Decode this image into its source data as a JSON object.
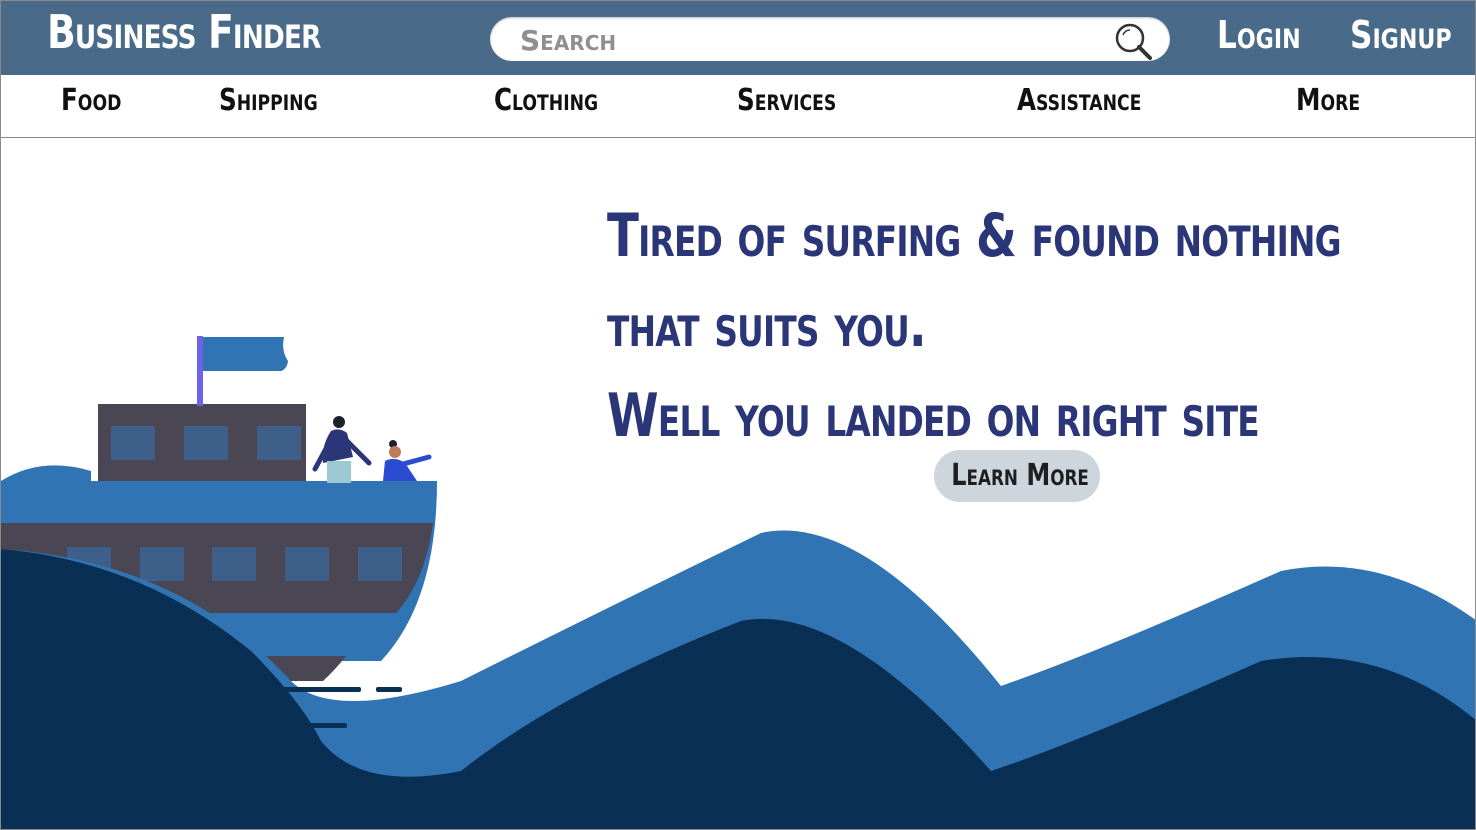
{
  "header": {
    "brand": "Business Finder",
    "search_placeholder": "Search",
    "login_label": "Login",
    "signup_label": "Signup"
  },
  "categories": [
    "Food",
    "Shipping",
    "Clothing",
    "Services",
    "Assistance",
    "More"
  ],
  "hero": {
    "line1": "Tired of surfing & found nothing",
    "line2": "that suits you.",
    "line3": "Well you landed on right site",
    "cta_label": "Learn More"
  },
  "colors": {
    "topbar": "#4a6a8a",
    "hero_text": "#2a3677",
    "wave_light": "#3174b3",
    "wave_dark": "#0a2f55",
    "ship_hull": "#4a4654",
    "button_bg": "#cdd5dd"
  },
  "icons": {
    "search": "magnifier-icon"
  }
}
